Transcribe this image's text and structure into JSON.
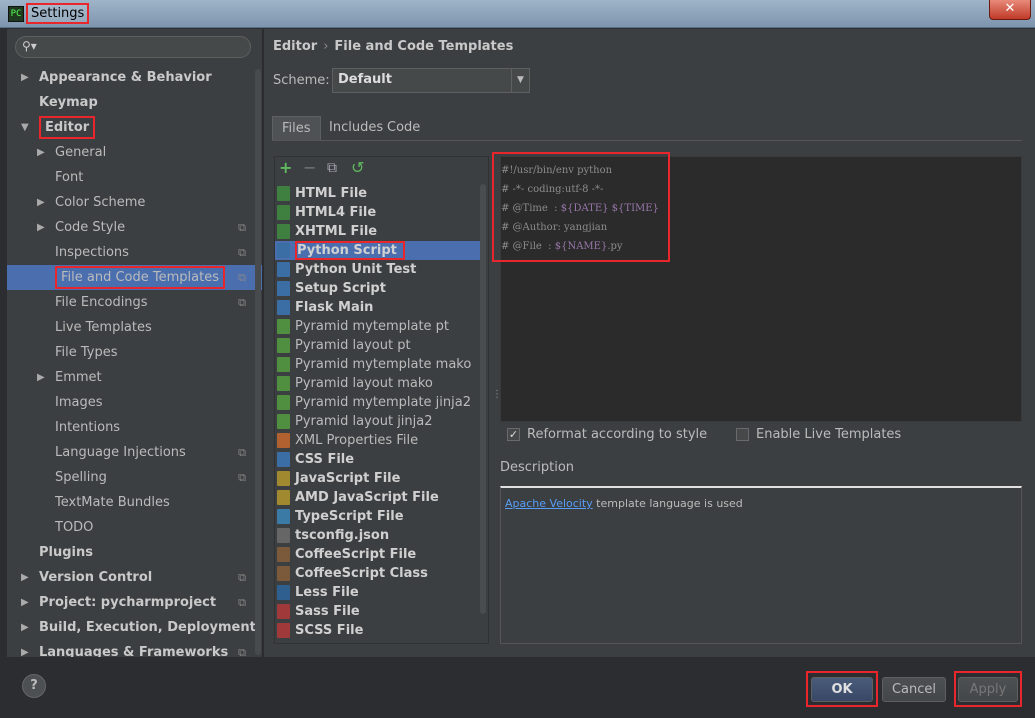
{
  "window": {
    "title": "Settings",
    "close_glyph": "✕",
    "icon_glyph": "PC"
  },
  "search": {
    "placeholder": "",
    "icon": "search-icon"
  },
  "tree": [
    {
      "label": "Appearance & Behavior",
      "level": 0,
      "arrow": "▶",
      "bold": true
    },
    {
      "label": "Keymap",
      "level": 0,
      "arrow": "",
      "bold": true
    },
    {
      "label": "Editor",
      "level": 0,
      "arrow": "▼",
      "bold": true,
      "highlighted": true
    },
    {
      "label": "General",
      "level": 1,
      "arrow": "▶"
    },
    {
      "label": "Font",
      "level": 1,
      "arrow": ""
    },
    {
      "label": "Color Scheme",
      "level": 1,
      "arrow": "▶"
    },
    {
      "label": "Code Style",
      "level": 1,
      "arrow": "▶",
      "cfg": true
    },
    {
      "label": "Inspections",
      "level": 1,
      "arrow": "",
      "cfg": true
    },
    {
      "label": "File and Code Templates",
      "level": 1,
      "arrow": "",
      "cfg": true,
      "selected": true,
      "highlighted": true
    },
    {
      "label": "File Encodings",
      "level": 1,
      "arrow": "",
      "cfg": true
    },
    {
      "label": "Live Templates",
      "level": 1,
      "arrow": ""
    },
    {
      "label": "File Types",
      "level": 1,
      "arrow": ""
    },
    {
      "label": "Emmet",
      "level": 1,
      "arrow": "▶"
    },
    {
      "label": "Images",
      "level": 1,
      "arrow": ""
    },
    {
      "label": "Intentions",
      "level": 1,
      "arrow": ""
    },
    {
      "label": "Language Injections",
      "level": 1,
      "arrow": "",
      "cfg": true
    },
    {
      "label": "Spelling",
      "level": 1,
      "arrow": "",
      "cfg": true
    },
    {
      "label": "TextMate Bundles",
      "level": 1,
      "arrow": ""
    },
    {
      "label": "TODO",
      "level": 1,
      "arrow": ""
    },
    {
      "label": "Plugins",
      "level": 0,
      "arrow": "",
      "bold": true
    },
    {
      "label": "Version Control",
      "level": 0,
      "arrow": "▶",
      "bold": true,
      "cfg": true
    },
    {
      "label": "Project: pycharmproject",
      "level": 0,
      "arrow": "▶",
      "bold": true,
      "cfg": true
    },
    {
      "label": "Build, Execution, Deployment",
      "level": 0,
      "arrow": "▶",
      "bold": true
    },
    {
      "label": "Languages & Frameworks",
      "level": 0,
      "arrow": "▶",
      "bold": true,
      "cfg": true
    }
  ],
  "breadcrumb": {
    "parent": "Editor",
    "separator": "›",
    "current": "File and Code Templates"
  },
  "scheme": {
    "label": "Scheme:",
    "value": "Default",
    "dropdown_glyph": "▼"
  },
  "tabs": [
    {
      "label": "Files",
      "active": true
    },
    {
      "label": "Includes"
    },
    {
      "label": "Code"
    }
  ],
  "toolbar": {
    "add": "+",
    "remove": "−",
    "copy": "⧉",
    "reset": "↺"
  },
  "files": [
    {
      "name": "HTML File",
      "bold": true,
      "icon": "html",
      "color": "#3f7f3f"
    },
    {
      "name": "HTML4 File",
      "bold": true,
      "icon": "html",
      "color": "#3f7f3f"
    },
    {
      "name": "XHTML File",
      "bold": true,
      "icon": "html",
      "color": "#3f7f3f"
    },
    {
      "name": "Python Script",
      "bold": true,
      "icon": "python",
      "color": "#3a6ea5",
      "selected": true
    },
    {
      "name": "Python Unit Test",
      "bold": true,
      "icon": "python",
      "color": "#3a6ea5"
    },
    {
      "name": "Setup Script",
      "bold": true,
      "icon": "python",
      "color": "#3a6ea5"
    },
    {
      "name": "Flask Main",
      "bold": true,
      "icon": "python",
      "color": "#3a6ea5"
    },
    {
      "name": "Pyramid mytemplate pt",
      "icon": "template",
      "color": "#4f8f3f"
    },
    {
      "name": "Pyramid layout pt",
      "icon": "template",
      "color": "#4f8f3f"
    },
    {
      "name": "Pyramid mytemplate mako",
      "icon": "template",
      "color": "#4f8f3f"
    },
    {
      "name": "Pyramid layout mako",
      "icon": "template",
      "color": "#4f8f3f"
    },
    {
      "name": "Pyramid mytemplate jinja2",
      "icon": "template",
      "color": "#4f8f3f"
    },
    {
      "name": "Pyramid layout jinja2",
      "icon": "template",
      "color": "#4f8f3f"
    },
    {
      "name": "XML Properties File",
      "icon": "xml",
      "color": "#b0612f"
    },
    {
      "name": "CSS File",
      "bold": true,
      "icon": "css",
      "color": "#3a6ea5"
    },
    {
      "name": "JavaScript File",
      "bold": true,
      "icon": "js",
      "color": "#a0892f"
    },
    {
      "name": "AMD JavaScript File",
      "bold": true,
      "icon": "js",
      "color": "#a0892f"
    },
    {
      "name": "TypeScript File",
      "bold": true,
      "icon": "ts",
      "color": "#3a7aa5"
    },
    {
      "name": "tsconfig.json",
      "bold": true,
      "icon": "json",
      "color": "#666666"
    },
    {
      "name": "CoffeeScript File",
      "bold": true,
      "icon": "coffee",
      "color": "#7a5a3a"
    },
    {
      "name": "CoffeeScript Class",
      "bold": true,
      "icon": "coffee",
      "color": "#7a5a3a"
    },
    {
      "name": "Less File",
      "bold": true,
      "icon": "less",
      "color": "#2f5f8f"
    },
    {
      "name": "Sass File",
      "bold": true,
      "icon": "sass",
      "color": "#a03a3a"
    },
    {
      "name": "SCSS File",
      "bold": true,
      "icon": "scss",
      "color": "#a03a3a"
    }
  ],
  "code_lines": [
    [
      {
        "t": "#!/usr/bin/env python"
      }
    ],
    [
      {
        "t": "# -*- coding:utf-8 -*-"
      }
    ],
    [
      {
        "t": "# @Time  : "
      },
      {
        "t": "${DATE}",
        "v": true
      },
      {
        "t": " "
      },
      {
        "t": "${TIME}",
        "v": true
      }
    ],
    [
      {
        "t": "# @Author: yangjian"
      }
    ],
    [
      {
        "t": "# @File  : "
      },
      {
        "t": "${NAME}",
        "v": true
      },
      {
        "t": ".py"
      }
    ]
  ],
  "options": {
    "reformat": {
      "label": "Reformat according to style",
      "checked": true
    },
    "live": {
      "label": "Enable Live Templates",
      "checked": false
    }
  },
  "description": {
    "label": "Description",
    "link": "Apache Velocity",
    "text": " template language is used"
  },
  "buttons": {
    "ok": "OK",
    "cancel": "Cancel",
    "apply": "Apply",
    "help": "?"
  },
  "colors": {
    "accent_selection": "#4b6eaf",
    "annotation_red": "#e8262c",
    "template_var": "#9876aa",
    "link": "#589df6"
  }
}
